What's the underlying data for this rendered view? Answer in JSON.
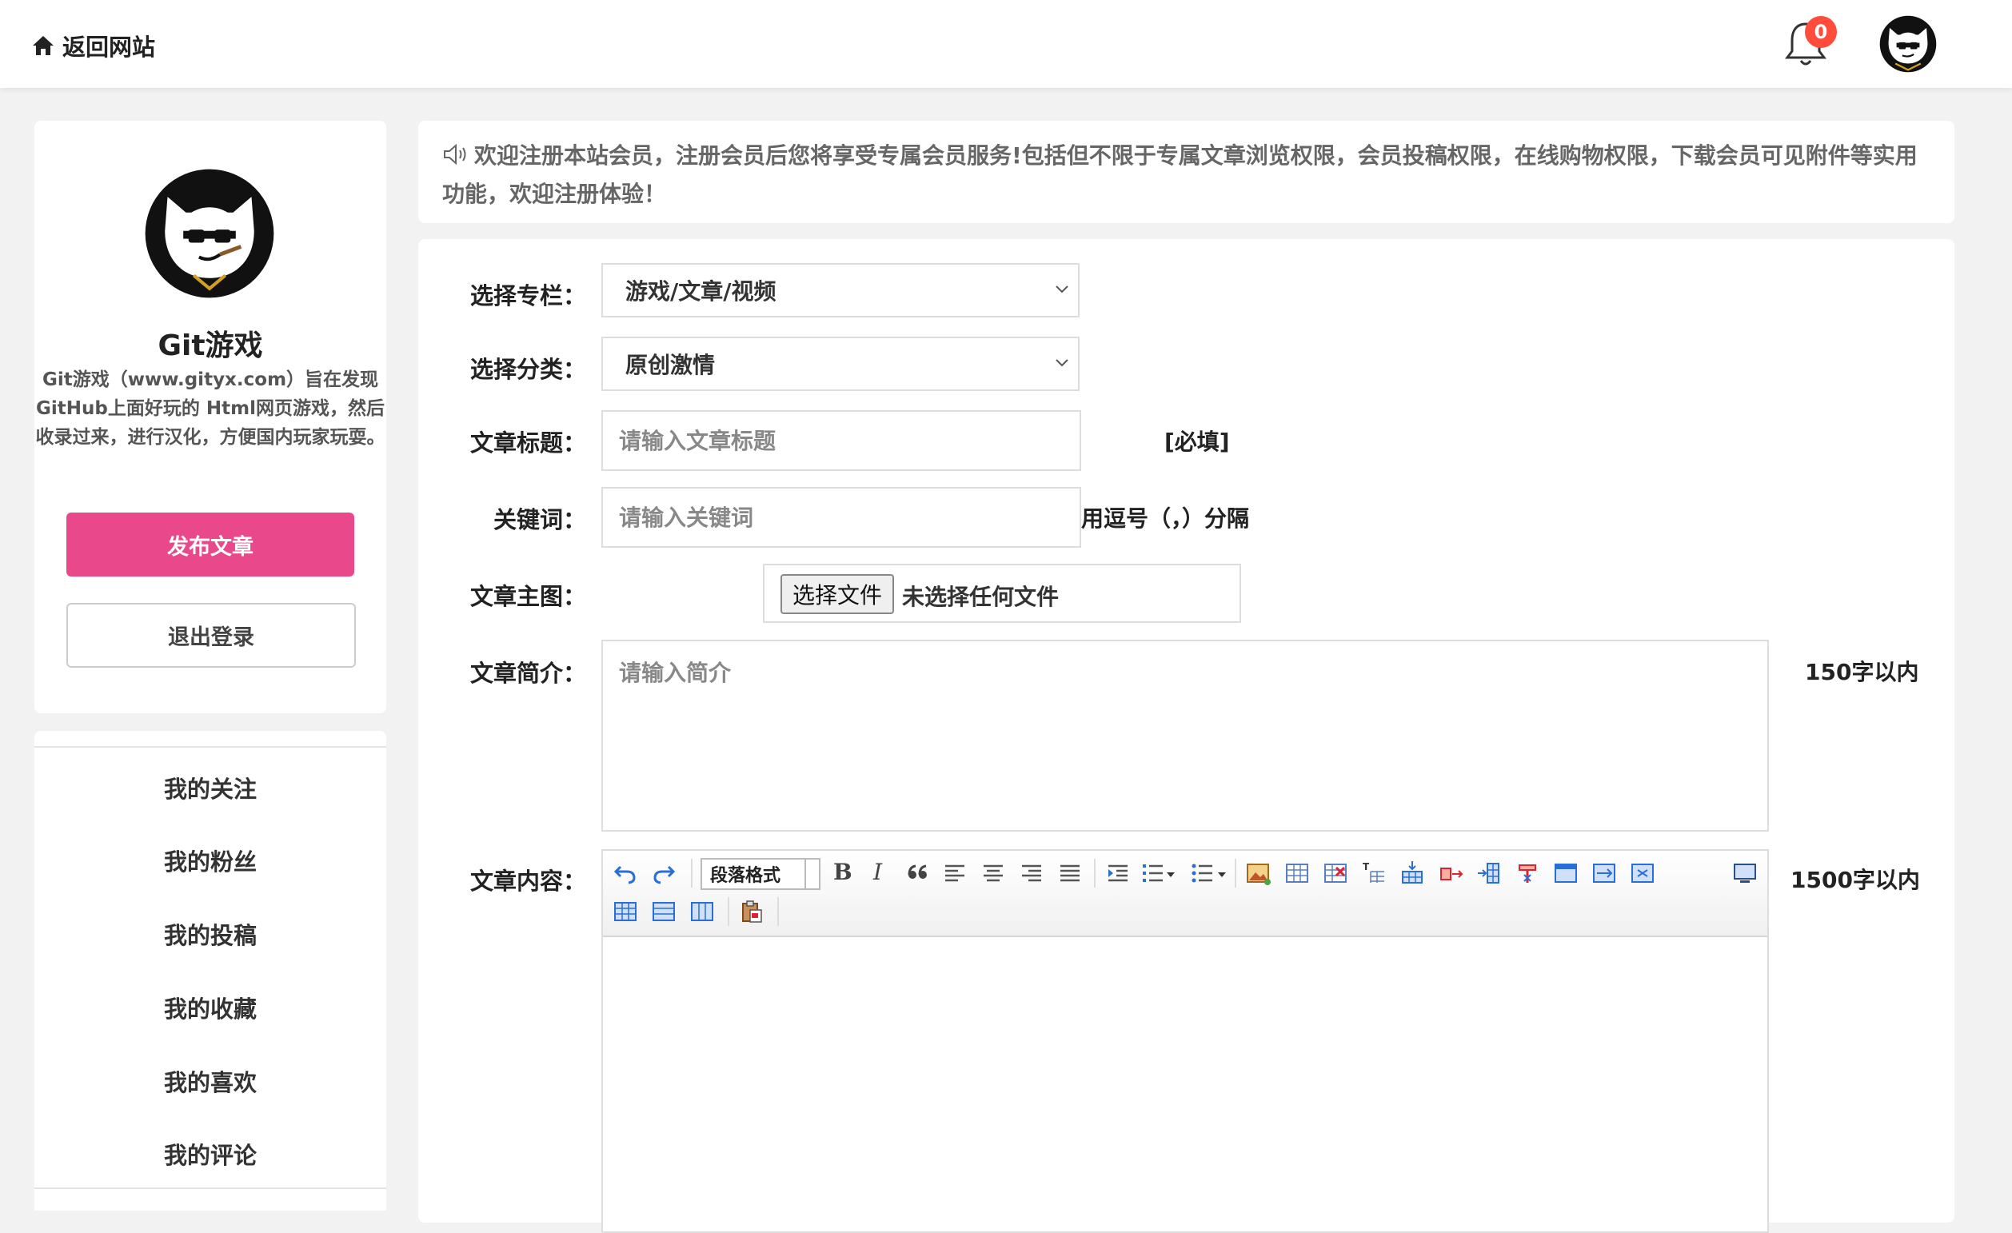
{
  "header": {
    "back_label": "返回网站",
    "notification_count": "0"
  },
  "profile": {
    "name": "Git游戏",
    "description": "Git游戏（www.gityx.com）旨在发现GitHub上面好玩的 Html网页游戏，然后收录过来，进行汉化，方便国内玩家玩耍。",
    "publish_label": "发布文章",
    "logout_label": "退出登录"
  },
  "menu": {
    "items": [
      {
        "label": "我的关注"
      },
      {
        "label": "我的粉丝"
      },
      {
        "label": "我的投稿"
      },
      {
        "label": "我的收藏"
      },
      {
        "label": "我的喜欢"
      },
      {
        "label": "我的评论"
      }
    ]
  },
  "notice": {
    "text": "欢迎注册本站会员，注册会员后您将享受专属会员服务!包括但不限于专属文章浏览权限，会员投稿权限，在线购物权限，下载会员可见附件等实用功能，欢迎注册体验！"
  },
  "form": {
    "column_label": "选择专栏：",
    "column_value": "游戏/文章/视频",
    "category_label": "选择分类：",
    "category_value": "原创激情",
    "title_label": "文章标题：",
    "title_placeholder": "请输入文章标题",
    "title_hint": "[必填]",
    "keywords_label": "关键词：",
    "keywords_placeholder": "请输入关键词",
    "keywords_hint": "用逗号（，）分隔",
    "image_label": "文章主图：",
    "file_button": "选择文件",
    "file_status": "未选择任何文件",
    "summary_label": "文章简介：",
    "summary_placeholder": "请输入简介",
    "summary_hint": "150字以内",
    "content_label": "文章内容：",
    "content_hint": "1500字以内"
  },
  "editor": {
    "paragraph_format": "段落格式",
    "bold_glyph": "B",
    "italic_glyph": "I"
  },
  "colors": {
    "primary_pink": "#e9498a",
    "badge_red": "#ff4c3b"
  }
}
